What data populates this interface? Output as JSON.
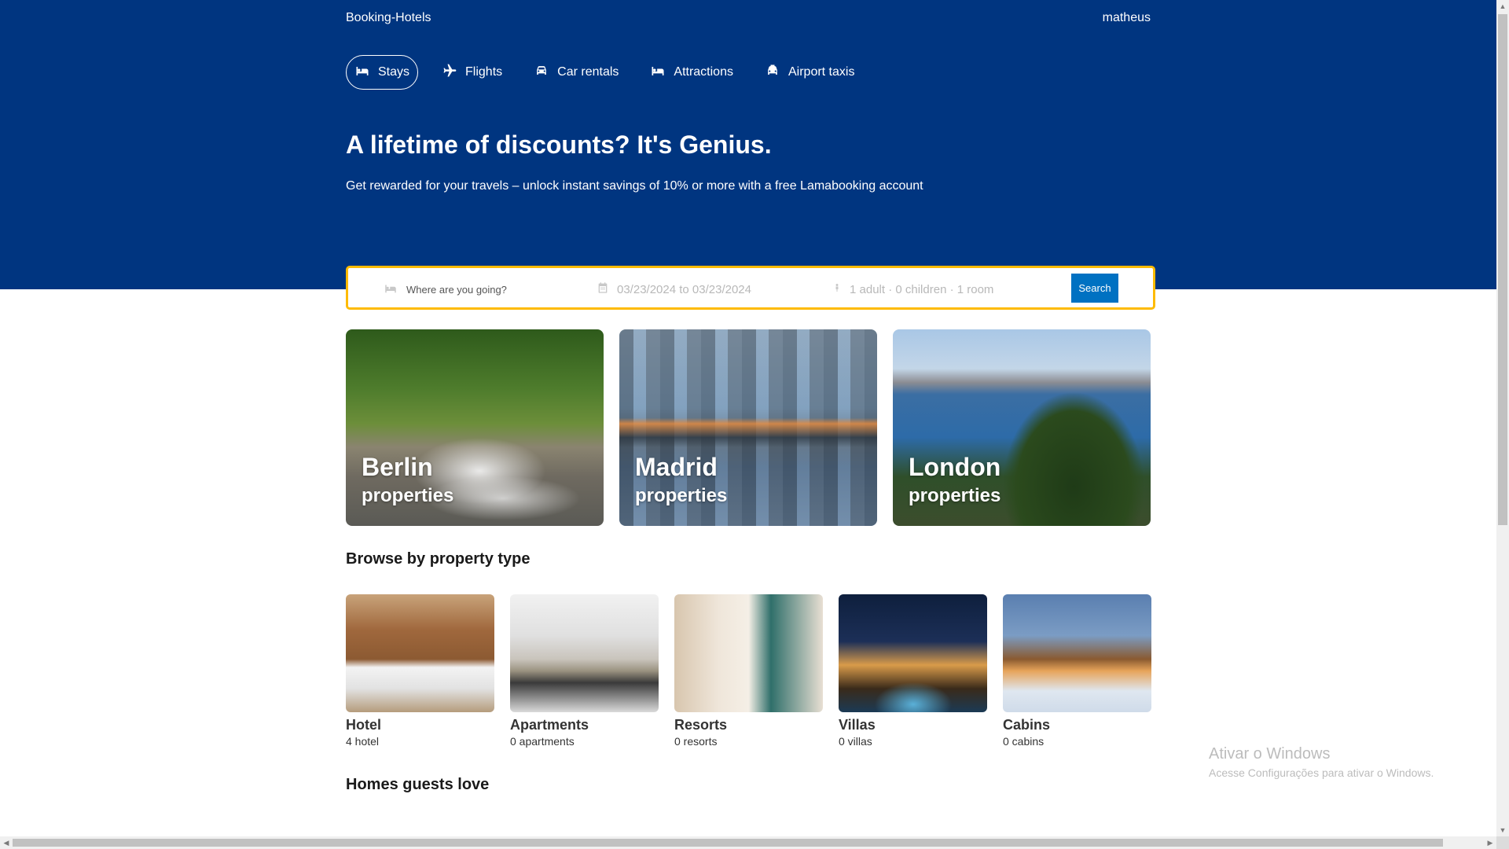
{
  "brand": "Booking-Hotels",
  "user": {
    "name": "matheus"
  },
  "nav": {
    "tabs": [
      {
        "label": "Stays",
        "icon": "bed-icon",
        "active": true
      },
      {
        "label": "Flights",
        "icon": "plane-icon",
        "active": false
      },
      {
        "label": "Car rentals",
        "icon": "car-icon",
        "active": false
      },
      {
        "label": "Attractions",
        "icon": "bed-icon",
        "active": false
      },
      {
        "label": "Airport taxis",
        "icon": "taxi-icon",
        "active": false
      }
    ]
  },
  "hero": {
    "title": "A lifetime of discounts? It's Genius.",
    "subtitle": "Get rewarded for your travels – unlock instant savings of 10% or more with a free Lamabooking account"
  },
  "search": {
    "destination_placeholder": "Where are you going?",
    "dates": "03/23/2024 to 03/23/2024",
    "guests": "1 adult · 0 children · 1 room",
    "button_label": "Search"
  },
  "featured": [
    {
      "name": "Berlin",
      "subtitle": "properties"
    },
    {
      "name": "Madrid",
      "subtitle": "properties"
    },
    {
      "name": "London",
      "subtitle": "properties"
    }
  ],
  "property_types": {
    "title": "Browse by property type",
    "items": [
      {
        "title": "Hotel",
        "count": "4 hotel"
      },
      {
        "title": "Apartments",
        "count": "0 apartments"
      },
      {
        "title": "Resorts",
        "count": "0 resorts"
      },
      {
        "title": "Villas",
        "count": "0 villas"
      },
      {
        "title": "Cabins",
        "count": "0 cabins"
      }
    ]
  },
  "homes_section": {
    "title": "Homes guests love"
  },
  "watermark": {
    "line1": "Ativar o Windows",
    "line2": "Acesse Configurações para ativar o Windows."
  },
  "colors": {
    "header_bg": "#003580",
    "search_border": "#febb02",
    "search_button": "#0071c2"
  }
}
